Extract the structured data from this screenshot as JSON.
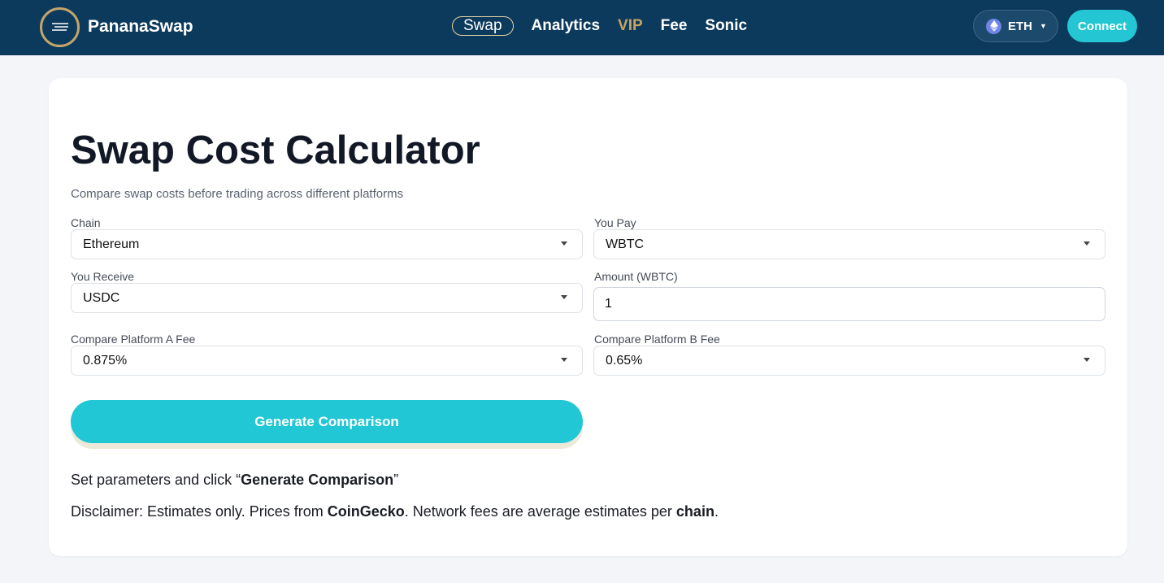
{
  "header": {
    "brand": "PananaSwap",
    "nav": [
      {
        "label": "Swap",
        "active": true
      },
      {
        "label": "Analytics"
      },
      {
        "label": "VIP"
      },
      {
        "label": "Fee"
      },
      {
        "label": "Sonic"
      }
    ],
    "network": "ETH",
    "connect_label": "Connect"
  },
  "calculator": {
    "title": "Swap Cost Calculator",
    "subtitle": "Compare swap costs before trading across different platforms",
    "chain": {
      "label": "Chain",
      "value": "Ethereum"
    },
    "you_pay": {
      "label": "You Pay",
      "value": "WBTC"
    },
    "you_receive": {
      "label": "You Receive",
      "value": "USDC"
    },
    "amount": {
      "label": "Amount (WBTC)",
      "value": "1"
    },
    "platform_a": {
      "label": "Compare Platform A Fee",
      "value": "0.875%"
    },
    "platform_b": {
      "label": "Compare Platform B Fee",
      "value": "0.65%"
    },
    "generate_label": "Generate Comparison",
    "instruction": {
      "prefix": "Set parameters and click “",
      "emphasis": "Generate Comparison",
      "suffix": "”"
    },
    "disclaimer": {
      "part1": "Disclaimer: Estimates only. Prices from ",
      "source": "CoinGecko",
      "part2": ". Network fees are average estimates per ",
      "chain_word": "chain",
      "part3": "."
    }
  },
  "colors": {
    "header_bg": "#0c3a5c",
    "accent": "#21c7d4",
    "gold": "#c7a461"
  }
}
